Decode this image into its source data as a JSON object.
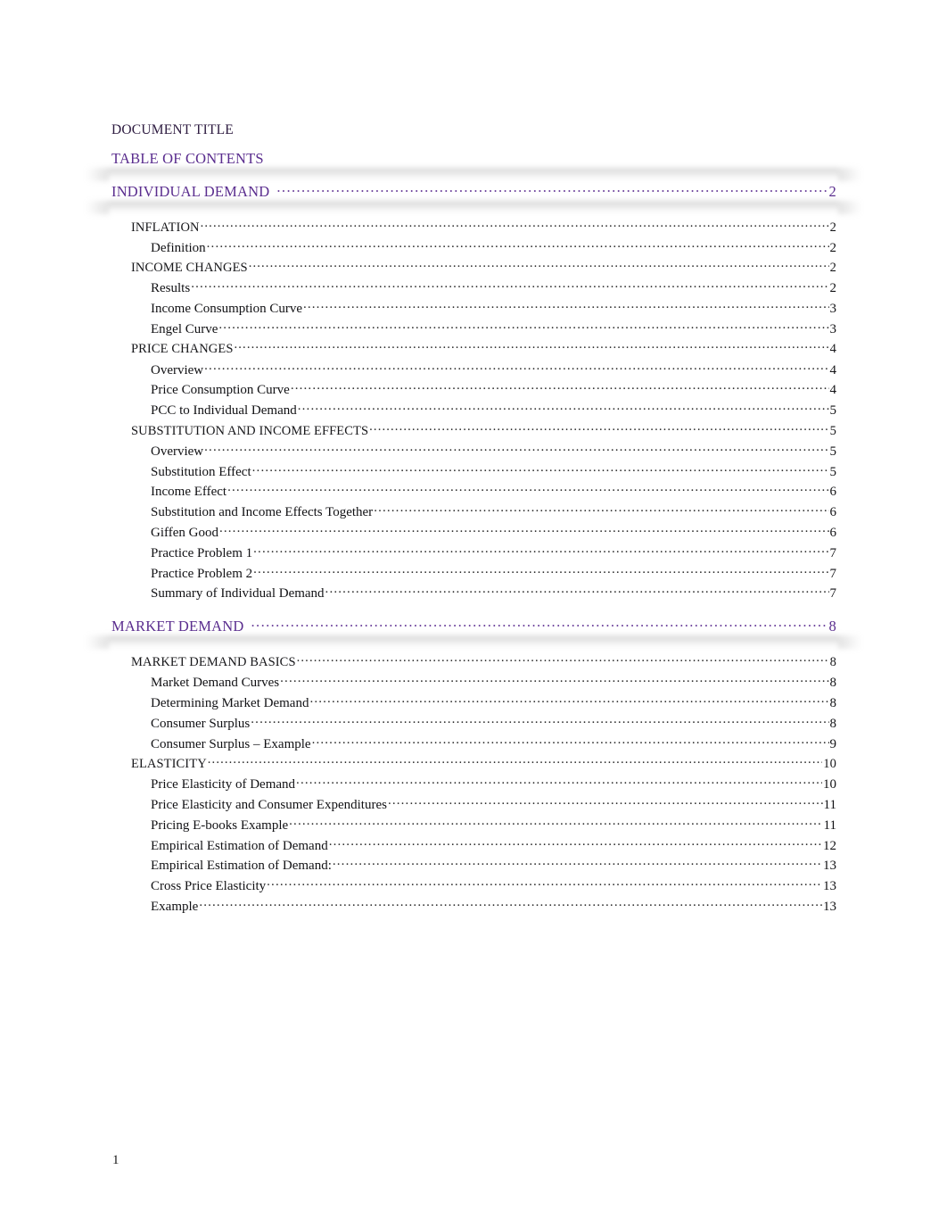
{
  "document": {
    "title": "DOCUMENT TITLE",
    "toc_heading": "TABLE OF CONTENTS",
    "page_number": "1"
  },
  "colors": {
    "heading_purple": "#5a2d8e",
    "title_dark": "#2d1b40",
    "body_black": "#111114",
    "page_background": "#ffffff"
  },
  "toc": {
    "entries": [
      {
        "level": 1,
        "label": "INDIVIDUAL DEMAND",
        "page": "2"
      },
      {
        "level": 2,
        "label": "INFLATION",
        "page": "2"
      },
      {
        "level": 3,
        "label": "Definition",
        "page": "2"
      },
      {
        "level": 2,
        "label": "INCOME CHANGES",
        "page": "2"
      },
      {
        "level": 3,
        "label": "Results",
        "page": "2"
      },
      {
        "level": 3,
        "label": "Income Consumption Curve",
        "page": "3"
      },
      {
        "level": 3,
        "label": "Engel Curve",
        "page": "3"
      },
      {
        "level": 2,
        "label": "PRICE CHANGES",
        "page": "4"
      },
      {
        "level": 3,
        "label": "Overview",
        "page": "4"
      },
      {
        "level": 3,
        "label": "Price Consumption Curve",
        "page": "4"
      },
      {
        "level": 3,
        "label": "PCC to Individual Demand",
        "page": "5"
      },
      {
        "level": 2,
        "label": "SUBSTITUTION AND INCOME EFFECTS",
        "page": "5"
      },
      {
        "level": 3,
        "label": "Overview",
        "page": "5"
      },
      {
        "level": 3,
        "label": "Substitution Effect",
        "page": "5"
      },
      {
        "level": 3,
        "label": "Income Effect",
        "page": "6"
      },
      {
        "level": 3,
        "label": "Substitution and Income Effects Together",
        "page": "6"
      },
      {
        "level": 3,
        "label": "Giffen Good",
        "page": "6"
      },
      {
        "level": 3,
        "label": "Practice Problem 1",
        "page": "7"
      },
      {
        "level": 3,
        "label": "Practice Problem 2",
        "page": "7"
      },
      {
        "level": 3,
        "label": "Summary of Individual Demand",
        "page": "7"
      },
      {
        "level": 1,
        "label": "MARKET DEMAND",
        "page": "8"
      },
      {
        "level": 2,
        "label": "MARKET DEMAND BASICS",
        "page": "8"
      },
      {
        "level": 3,
        "label": "Market Demand Curves",
        "page": "8"
      },
      {
        "level": 3,
        "label": "Determining Market Demand",
        "page": "8"
      },
      {
        "level": 3,
        "label": "Consumer Surplus",
        "page": "8"
      },
      {
        "level": 3,
        "label": "Consumer Surplus – Example",
        "page": "9"
      },
      {
        "level": 2,
        "label": "ELASTICITY",
        "page": "10"
      },
      {
        "level": 3,
        "label": "Price Elasticity of Demand",
        "page": "10"
      },
      {
        "level": 3,
        "label": "Price Elasticity and Consumer Expenditures",
        "page": "11"
      },
      {
        "level": 3,
        "label": "Pricing E-books Example",
        "page": "11"
      },
      {
        "level": 3,
        "label": "Empirical Estimation of Demand",
        "page": "12"
      },
      {
        "level": 3,
        "label": "Empirical Estimation of Demand:",
        "page": "13"
      },
      {
        "level": 3,
        "label": "Cross Price Elasticity",
        "page": "13"
      },
      {
        "level": 3,
        "label": "Example",
        "page": "13"
      }
    ]
  }
}
